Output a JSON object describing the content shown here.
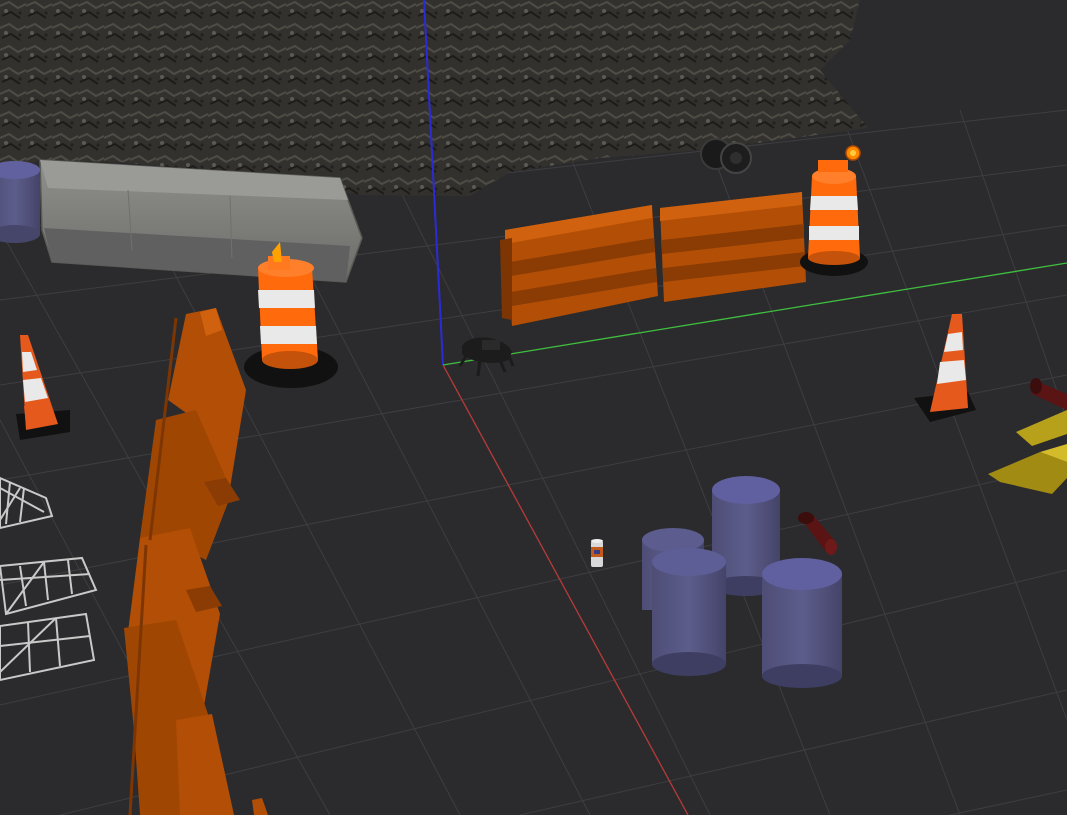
{
  "scene": {
    "background_color": "#2b2b2d",
    "grid_color": "#3e3e42",
    "axis_colors": {
      "x": "#b83a3a",
      "y": "#3fbf3f",
      "z": "#2b2bd6"
    },
    "colors": {
      "barrier_orange": "#b24e05",
      "barrier_orange_dark": "#7d3603",
      "cone_orange": "#e5591d",
      "cone_white": "#e9e9e9",
      "drum_orange": "#ff6a0d",
      "cylinder_blue": "#575783",
      "concrete_gray": "#8a8a86",
      "rubble_dark": "#3c3a36",
      "truss_white": "#c9c9c9",
      "ramp_yellow": "#b8a11a",
      "robot_black": "#1c1c1c",
      "flashlight_red": "#5a1414"
    },
    "objects": [
      {
        "name": "rubble-pile",
        "icon": "rock-heap-icon"
      },
      {
        "name": "concrete-jersey-barrier",
        "icon": "concrete-barrier-icon"
      },
      {
        "name": "traffic-drum-left",
        "icon": "traffic-drum-icon"
      },
      {
        "name": "traffic-drum-right",
        "icon": "traffic-drum-icon"
      },
      {
        "name": "plastic-barrier-left",
        "icon": "road-barrier-icon"
      },
      {
        "name": "plastic-barrier-right",
        "icon": "road-barrier-icon"
      },
      {
        "name": "plastic-barrier-row",
        "icon": "road-barrier-icon"
      },
      {
        "name": "traffic-cone-left",
        "icon": "traffic-cone-icon"
      },
      {
        "name": "traffic-cone-right",
        "icon": "traffic-cone-icon"
      },
      {
        "name": "tire-pair",
        "icon": "tire-icon"
      },
      {
        "name": "quadruped-robot",
        "icon": "robot-icon"
      },
      {
        "name": "soda-can",
        "icon": "can-icon"
      },
      {
        "name": "blue-cylinders-group",
        "icon": "cylinder-icon"
      },
      {
        "name": "flashlight-near",
        "icon": "flashlight-icon"
      },
      {
        "name": "flashlight-far",
        "icon": "flashlight-icon"
      },
      {
        "name": "truss-stack",
        "icon": "truss-icon"
      },
      {
        "name": "yellow-ramp",
        "icon": "ramp-icon"
      },
      {
        "name": "world-origin-axes",
        "icon": "axes-icon"
      }
    ]
  }
}
